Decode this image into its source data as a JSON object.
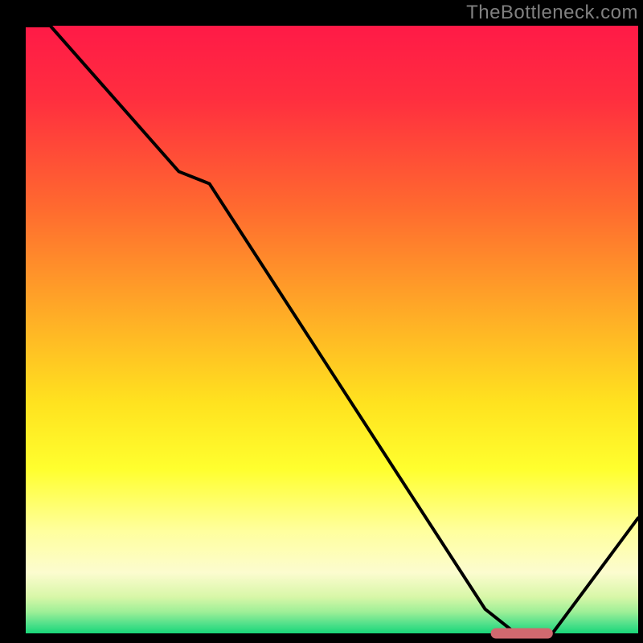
{
  "watermark": "TheBottleneck.com",
  "chart_data": {
    "type": "line",
    "title": "",
    "xlabel": "",
    "ylabel": "",
    "xlim": [
      0,
      100
    ],
    "ylim": [
      0,
      100
    ],
    "x": [
      0,
      4,
      25,
      30,
      75,
      80,
      86,
      100
    ],
    "values": [
      104,
      100,
      76,
      74,
      4,
      0,
      0,
      19
    ],
    "marker": {
      "x_start": 76,
      "x_end": 86,
      "y": 0
    },
    "colors": {
      "gradient_stops": [
        {
          "offset": 0.0,
          "color": "#ff1a47"
        },
        {
          "offset": 0.12,
          "color": "#ff2e3f"
        },
        {
          "offset": 0.3,
          "color": "#ff6a2f"
        },
        {
          "offset": 0.48,
          "color": "#ffae26"
        },
        {
          "offset": 0.62,
          "color": "#ffe21f"
        },
        {
          "offset": 0.73,
          "color": "#ffff2e"
        },
        {
          "offset": 0.83,
          "color": "#ffff9c"
        },
        {
          "offset": 0.9,
          "color": "#fcfccf"
        },
        {
          "offset": 0.94,
          "color": "#d8f7a8"
        },
        {
          "offset": 0.965,
          "color": "#9def97"
        },
        {
          "offset": 0.985,
          "color": "#4fe08a"
        },
        {
          "offset": 1.0,
          "color": "#19d779"
        }
      ],
      "line": "#000000",
      "marker_fill": "#d1696f",
      "marker_stroke": "#d1696f"
    }
  }
}
